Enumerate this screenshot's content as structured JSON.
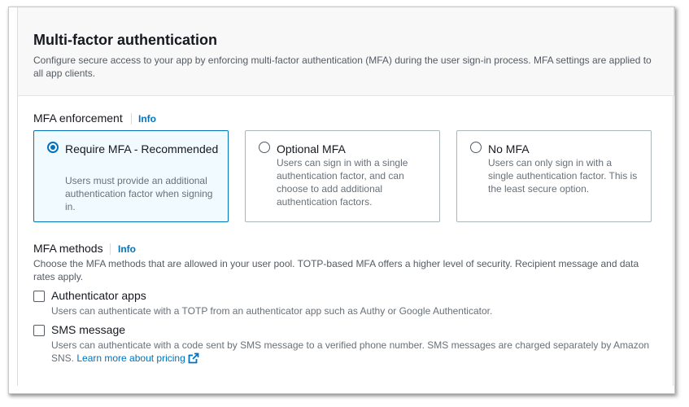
{
  "header": {
    "title": "Multi-factor authentication",
    "description": "Configure secure access to your app by enforcing multi-factor authentication (MFA) during the user sign-in process. MFA settings are applied to all app clients."
  },
  "enforcement": {
    "label": "MFA enforcement",
    "info": "Info",
    "options": [
      {
        "title": "Require MFA - Recommended",
        "description": "Users must provide an additional authentication factor when signing in.",
        "selected": true
      },
      {
        "title": "Optional MFA",
        "description": "Users can sign in with a single authentication factor, and can choose to add additional authentication factors.",
        "selected": false
      },
      {
        "title": "No MFA",
        "description": "Users can only sign in with a single authentication factor. This is the least secure option.",
        "selected": false
      }
    ]
  },
  "methods": {
    "label": "MFA methods",
    "info": "Info",
    "description": "Choose the MFA methods that are allowed in your user pool. TOTP-based MFA offers a higher level of security. Recipient message and data rates apply.",
    "items": [
      {
        "label": "Authenticator apps",
        "description": "Users can authenticate with a TOTP from an authenticator app such as Authy or Google Authenticator.",
        "checked": false
      },
      {
        "label": "SMS message",
        "description": "Users can authenticate with a code sent by SMS message to a verified phone number. SMS messages are charged separately by Amazon SNS.",
        "link": "Learn more about pricing",
        "checked": false
      }
    ]
  },
  "colors": {
    "accent": "#0073bb",
    "text": "#16191f",
    "muted": "#687078",
    "selected_bg": "#f1faff"
  },
  "icons": {
    "external_link": "external-link-icon"
  }
}
